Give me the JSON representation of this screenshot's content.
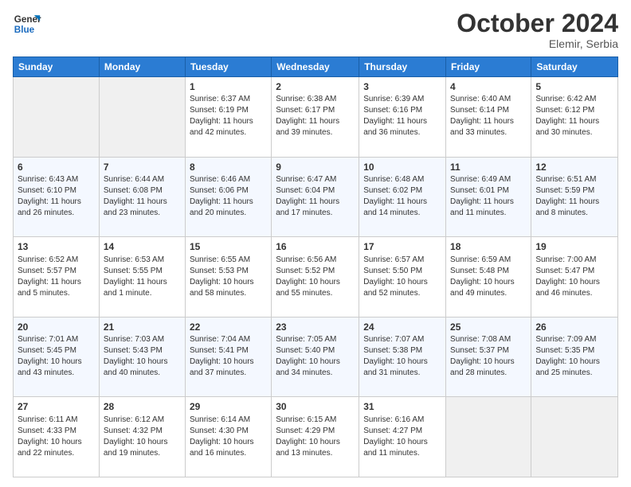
{
  "header": {
    "logo": {
      "line1": "General",
      "line2": "Blue"
    },
    "title": "October 2024",
    "subtitle": "Elemir, Serbia"
  },
  "weekdays": [
    "Sunday",
    "Monday",
    "Tuesday",
    "Wednesday",
    "Thursday",
    "Friday",
    "Saturday"
  ],
  "weeks": [
    [
      {
        "day": "",
        "sunrise": "",
        "sunset": "",
        "daylight": ""
      },
      {
        "day": "",
        "sunrise": "",
        "sunset": "",
        "daylight": ""
      },
      {
        "day": "1",
        "sunrise": "Sunrise: 6:37 AM",
        "sunset": "Sunset: 6:19 PM",
        "daylight": "Daylight: 11 hours and 42 minutes."
      },
      {
        "day": "2",
        "sunrise": "Sunrise: 6:38 AM",
        "sunset": "Sunset: 6:17 PM",
        "daylight": "Daylight: 11 hours and 39 minutes."
      },
      {
        "day": "3",
        "sunrise": "Sunrise: 6:39 AM",
        "sunset": "Sunset: 6:16 PM",
        "daylight": "Daylight: 11 hours and 36 minutes."
      },
      {
        "day": "4",
        "sunrise": "Sunrise: 6:40 AM",
        "sunset": "Sunset: 6:14 PM",
        "daylight": "Daylight: 11 hours and 33 minutes."
      },
      {
        "day": "5",
        "sunrise": "Sunrise: 6:42 AM",
        "sunset": "Sunset: 6:12 PM",
        "daylight": "Daylight: 11 hours and 30 minutes."
      }
    ],
    [
      {
        "day": "6",
        "sunrise": "Sunrise: 6:43 AM",
        "sunset": "Sunset: 6:10 PM",
        "daylight": "Daylight: 11 hours and 26 minutes."
      },
      {
        "day": "7",
        "sunrise": "Sunrise: 6:44 AM",
        "sunset": "Sunset: 6:08 PM",
        "daylight": "Daylight: 11 hours and 23 minutes."
      },
      {
        "day": "8",
        "sunrise": "Sunrise: 6:46 AM",
        "sunset": "Sunset: 6:06 PM",
        "daylight": "Daylight: 11 hours and 20 minutes."
      },
      {
        "day": "9",
        "sunrise": "Sunrise: 6:47 AM",
        "sunset": "Sunset: 6:04 PM",
        "daylight": "Daylight: 11 hours and 17 minutes."
      },
      {
        "day": "10",
        "sunrise": "Sunrise: 6:48 AM",
        "sunset": "Sunset: 6:02 PM",
        "daylight": "Daylight: 11 hours and 14 minutes."
      },
      {
        "day": "11",
        "sunrise": "Sunrise: 6:49 AM",
        "sunset": "Sunset: 6:01 PM",
        "daylight": "Daylight: 11 hours and 11 minutes."
      },
      {
        "day": "12",
        "sunrise": "Sunrise: 6:51 AM",
        "sunset": "Sunset: 5:59 PM",
        "daylight": "Daylight: 11 hours and 8 minutes."
      }
    ],
    [
      {
        "day": "13",
        "sunrise": "Sunrise: 6:52 AM",
        "sunset": "Sunset: 5:57 PM",
        "daylight": "Daylight: 11 hours and 5 minutes."
      },
      {
        "day": "14",
        "sunrise": "Sunrise: 6:53 AM",
        "sunset": "Sunset: 5:55 PM",
        "daylight": "Daylight: 11 hours and 1 minute."
      },
      {
        "day": "15",
        "sunrise": "Sunrise: 6:55 AM",
        "sunset": "Sunset: 5:53 PM",
        "daylight": "Daylight: 10 hours and 58 minutes."
      },
      {
        "day": "16",
        "sunrise": "Sunrise: 6:56 AM",
        "sunset": "Sunset: 5:52 PM",
        "daylight": "Daylight: 10 hours and 55 minutes."
      },
      {
        "day": "17",
        "sunrise": "Sunrise: 6:57 AM",
        "sunset": "Sunset: 5:50 PM",
        "daylight": "Daylight: 10 hours and 52 minutes."
      },
      {
        "day": "18",
        "sunrise": "Sunrise: 6:59 AM",
        "sunset": "Sunset: 5:48 PM",
        "daylight": "Daylight: 10 hours and 49 minutes."
      },
      {
        "day": "19",
        "sunrise": "Sunrise: 7:00 AM",
        "sunset": "Sunset: 5:47 PM",
        "daylight": "Daylight: 10 hours and 46 minutes."
      }
    ],
    [
      {
        "day": "20",
        "sunrise": "Sunrise: 7:01 AM",
        "sunset": "Sunset: 5:45 PM",
        "daylight": "Daylight: 10 hours and 43 minutes."
      },
      {
        "day": "21",
        "sunrise": "Sunrise: 7:03 AM",
        "sunset": "Sunset: 5:43 PM",
        "daylight": "Daylight: 10 hours and 40 minutes."
      },
      {
        "day": "22",
        "sunrise": "Sunrise: 7:04 AM",
        "sunset": "Sunset: 5:41 PM",
        "daylight": "Daylight: 10 hours and 37 minutes."
      },
      {
        "day": "23",
        "sunrise": "Sunrise: 7:05 AM",
        "sunset": "Sunset: 5:40 PM",
        "daylight": "Daylight: 10 hours and 34 minutes."
      },
      {
        "day": "24",
        "sunrise": "Sunrise: 7:07 AM",
        "sunset": "Sunset: 5:38 PM",
        "daylight": "Daylight: 10 hours and 31 minutes."
      },
      {
        "day": "25",
        "sunrise": "Sunrise: 7:08 AM",
        "sunset": "Sunset: 5:37 PM",
        "daylight": "Daylight: 10 hours and 28 minutes."
      },
      {
        "day": "26",
        "sunrise": "Sunrise: 7:09 AM",
        "sunset": "Sunset: 5:35 PM",
        "daylight": "Daylight: 10 hours and 25 minutes."
      }
    ],
    [
      {
        "day": "27",
        "sunrise": "Sunrise: 6:11 AM",
        "sunset": "Sunset: 4:33 PM",
        "daylight": "Daylight: 10 hours and 22 minutes."
      },
      {
        "day": "28",
        "sunrise": "Sunrise: 6:12 AM",
        "sunset": "Sunset: 4:32 PM",
        "daylight": "Daylight: 10 hours and 19 minutes."
      },
      {
        "day": "29",
        "sunrise": "Sunrise: 6:14 AM",
        "sunset": "Sunset: 4:30 PM",
        "daylight": "Daylight: 10 hours and 16 minutes."
      },
      {
        "day": "30",
        "sunrise": "Sunrise: 6:15 AM",
        "sunset": "Sunset: 4:29 PM",
        "daylight": "Daylight: 10 hours and 13 minutes."
      },
      {
        "day": "31",
        "sunrise": "Sunrise: 6:16 AM",
        "sunset": "Sunset: 4:27 PM",
        "daylight": "Daylight: 10 hours and 11 minutes."
      },
      {
        "day": "",
        "sunrise": "",
        "sunset": "",
        "daylight": ""
      },
      {
        "day": "",
        "sunrise": "",
        "sunset": "",
        "daylight": ""
      }
    ]
  ]
}
